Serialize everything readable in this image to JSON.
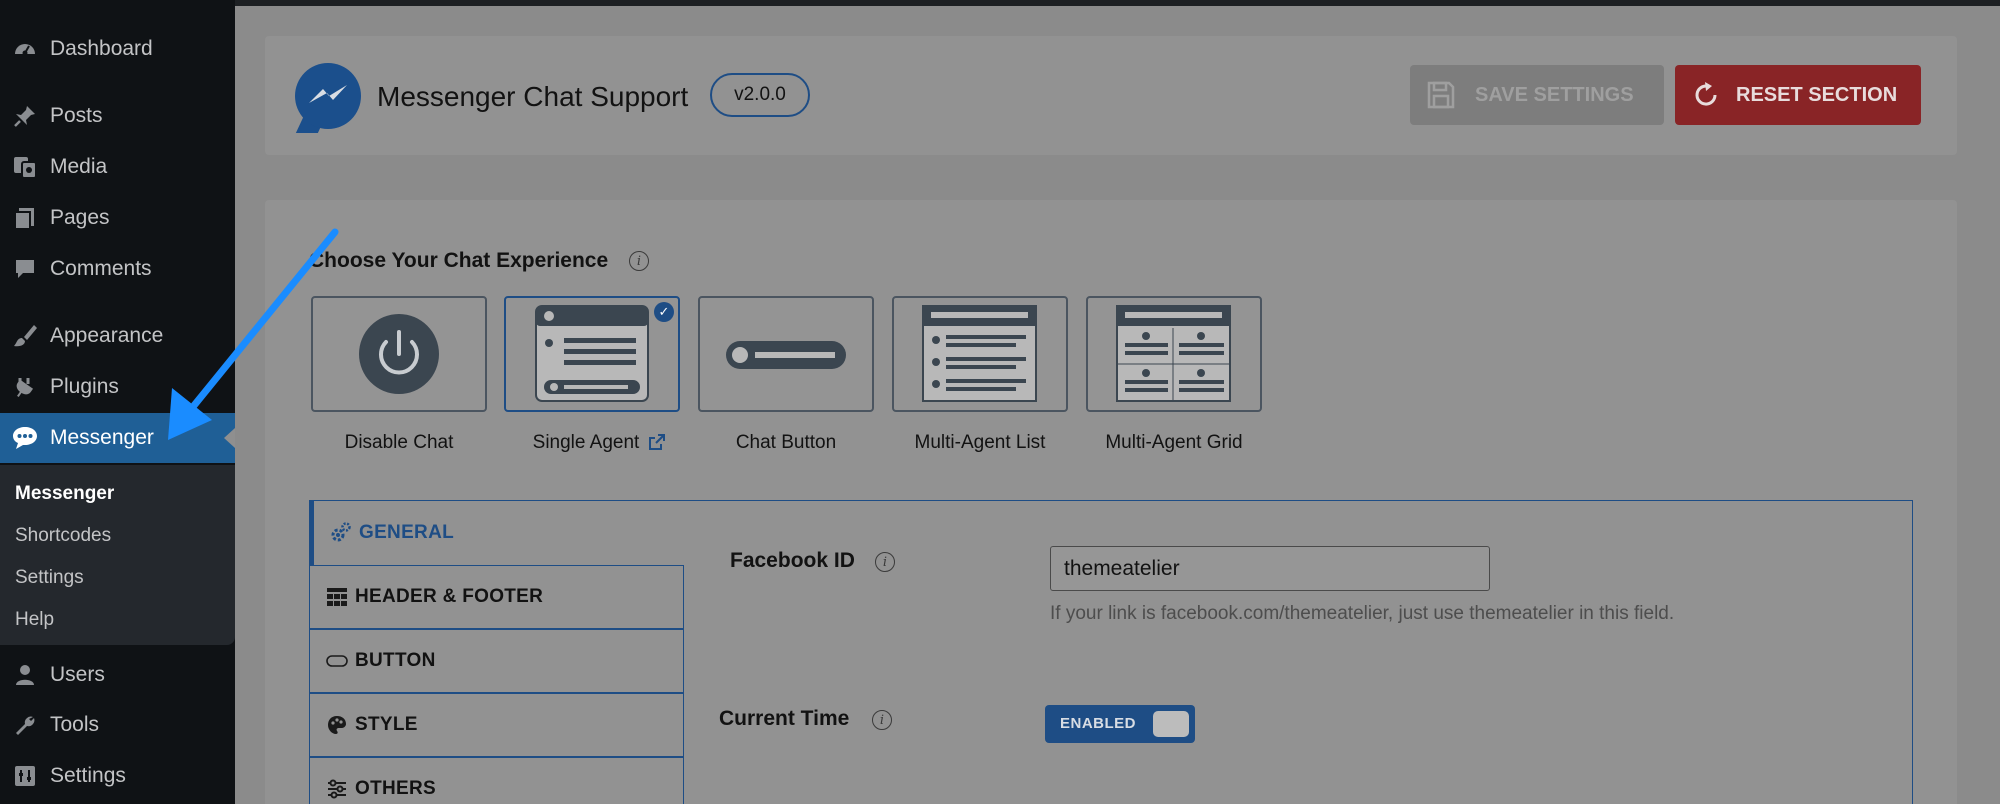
{
  "sidebar": {
    "items": [
      {
        "label": "Dashboard",
        "icon": "dashboard-icon"
      },
      {
        "label": "Posts",
        "icon": "pin-icon"
      },
      {
        "label": "Media",
        "icon": "media-icon"
      },
      {
        "label": "Pages",
        "icon": "pages-icon"
      },
      {
        "label": "Comments",
        "icon": "comment-icon"
      },
      {
        "label": "Appearance",
        "icon": "brush-icon"
      },
      {
        "label": "Plugins",
        "icon": "plugin-icon"
      },
      {
        "label": "Messenger",
        "icon": "chat-bubble-icon"
      },
      {
        "label": "Users",
        "icon": "user-icon"
      },
      {
        "label": "Tools",
        "icon": "wrench-icon"
      },
      {
        "label": "Settings",
        "icon": "settings-icon"
      }
    ],
    "submenu": [
      "Messenger",
      "Shortcodes",
      "Settings",
      "Help"
    ]
  },
  "header": {
    "title": "Messenger Chat Support",
    "version": "v2.0.0",
    "save_label": "SAVE SETTINGS",
    "reset_label": "RESET SECTION"
  },
  "experience": {
    "title": "Choose Your Chat Experience",
    "options": [
      "Disable Chat",
      "Single Agent",
      "Chat Button",
      "Multi-Agent List",
      "Multi-Agent Grid"
    ],
    "selected": "Single Agent"
  },
  "tabs": [
    "GENERAL",
    "HEADER & FOOTER",
    "BUTTON",
    "STYLE",
    "OTHERS"
  ],
  "fields": {
    "facebook_id_label": "Facebook ID",
    "facebook_id_value": "themeatelier",
    "facebook_id_hint": "If your link is facebook.com/themeatelier, just use themeatelier in this field.",
    "current_time_label": "Current Time",
    "current_time_toggle": "ENABLED"
  },
  "colors": {
    "accent": "#1e4d85",
    "reset": "#892426",
    "sidebar_active": "#1f5f96",
    "arrow": "#1a8cff"
  }
}
